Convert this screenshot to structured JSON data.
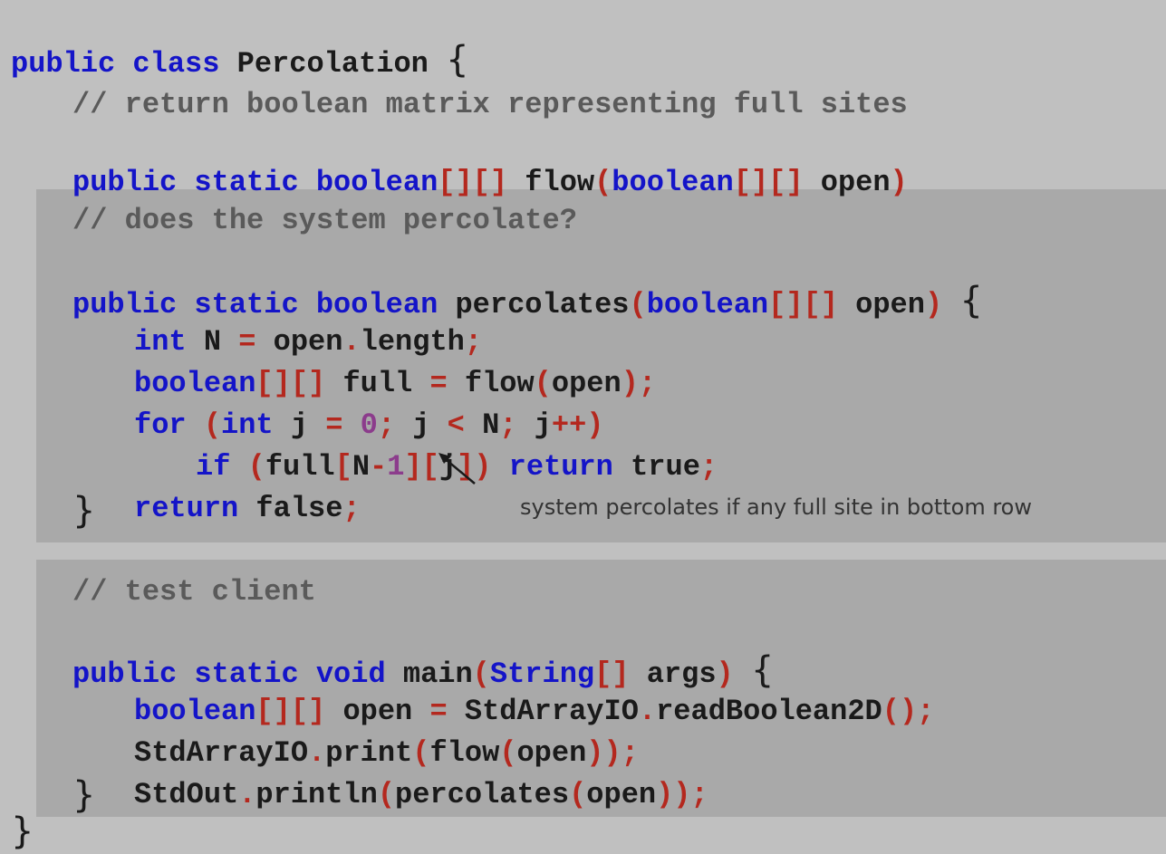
{
  "code": {
    "class_open": {
      "kw1": "public",
      "kw2": "class",
      "name": "Percolation",
      "brace": "{"
    },
    "flow_method": {
      "comment": "// return boolean matrix representing full sites",
      "signature": {
        "public": "public",
        "static": "static",
        "type": "boolean",
        "brackets1": "[][]",
        "name": "flow",
        "paren_open": "(",
        "param_type": "boolean",
        "brackets2": "[][]",
        "param": "open",
        "paren_close": ")"
      }
    },
    "percolates_method": {
      "comment": "// does the system percolate?",
      "signature": {
        "public": "public",
        "static": "static",
        "type": "boolean",
        "name": "percolates",
        "paren_open": "(",
        "param_type": "boolean",
        "brackets": "[][]",
        "param": "open",
        "paren_close": ")",
        "brace": "{"
      },
      "line1": {
        "type": "int",
        "var": "N",
        "eq": "=",
        "obj": "open",
        "dot": ".",
        "field": "length",
        "semi": ";"
      },
      "line2": {
        "type": "boolean",
        "brackets": "[][]",
        "var": "full",
        "eq": "=",
        "call": "flow",
        "po": "(",
        "arg": "open",
        "pc": ")",
        "semi": ";"
      },
      "line3": {
        "for": "for",
        "po": "(",
        "int": "int",
        "j1": "j",
        "eq": "=",
        "zero": "0",
        "semi1": ";",
        "j2": "j",
        "lt": "<",
        "N": "N",
        "semi2": ";",
        "j3": "j",
        "inc": "++",
        "pc": ")"
      },
      "line4": {
        "if": "if",
        "po": "(",
        "full": "full",
        "b1": "[",
        "N": "N",
        "minus": "-",
        "one": "1",
        "b2": "][",
        "j": "j",
        "b3": "])",
        "ret": "return",
        "val": "true",
        "semi": ";"
      },
      "line5": {
        "ret": "return",
        "val": "false",
        "semi": ";"
      },
      "close": "}"
    },
    "main_method": {
      "comment": "// test client",
      "signature": {
        "public": "public",
        "static": "static",
        "type": "void",
        "name": "main",
        "po": "(",
        "param_type": "String",
        "brackets": "[]",
        "param": "args",
        "pc": ")",
        "brace": "{"
      },
      "line1": {
        "type": "boolean",
        "brackets": "[][]",
        "var": "open",
        "eq": "=",
        "obj": "StdArrayIO",
        "dot": ".",
        "call": "readBoolean2D",
        "parens": "()",
        "semi": ";"
      },
      "line2": {
        "obj": "StdArrayIO",
        "dot": ".",
        "call": "print",
        "po1": "(",
        "call2": "flow",
        "po2": "(",
        "arg": "open",
        "pc": "))",
        "semi": ";"
      },
      "line3": {
        "obj": "StdOut",
        "dot": ".",
        "call": "println",
        "po1": "(",
        "call2": "percolates",
        "po2": "(",
        "arg": "open",
        "pc": "))",
        "semi": ";"
      },
      "close": "}"
    },
    "class_close": "}"
  },
  "annotation": "system percolates if any full site in bottom row",
  "colors": {
    "background": "#c0c0c0",
    "block": "#a9a9a9",
    "keyword": "#1414c8",
    "operator": "#b4281e",
    "number": "#8c3c8c",
    "comment": "#5a5a5a"
  }
}
